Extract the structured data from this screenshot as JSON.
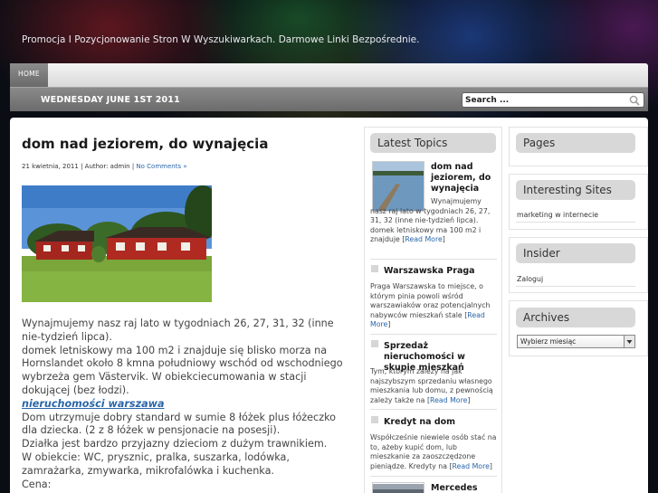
{
  "site": {
    "tagline": "Promocja I Pozycjonowanie Stron W Wyszukiwarkach. Darmowe Linki Bezpośrednie."
  },
  "nav": {
    "home_label": "HOME"
  },
  "datebar": {
    "date": "WEDNESDAY JUNE 1ST 2011"
  },
  "search": {
    "placeholder": "Search ..."
  },
  "post": {
    "title": "dom nad jeziorem, do wynajęcia",
    "meta_prefix": "21 kwietnia, 2011 | Author: admin | ",
    "comments_link": "No Comments »",
    "paragraphs": [
      "Wynajmujemy nasz raj lato w tygodniach 26, 27, 31, 32 (inne nie-tydzień lipca).",
      "domek letniskowy ma 100 m2 i znajduje się blisko morza na Hornslandet około 8 kmna południowy wschód od wschodniego wybrzeża gem Västervik. W obiekciecumowania w stacji dokującej (bez łodzi)."
    ],
    "keyword_link": "nieruchomości warszawa",
    "paragraphs2": [
      "Dom utrzymuje dobry standard w sumie 8 łóżek plus łóżeczko dla dziecka. (2 z 8 łóżek w pensjonacie na posesji).",
      "Działka jest bardzo przyjazny dzieciom z dużym trawnikiem.",
      "W obiekcie: WC, prysznic, pralka, suszarka, lodówka, zamrażarka, zmywarka, mikrofalówka i kuchenka.",
      "Cena:"
    ]
  },
  "latest_topics": {
    "heading": "Latest Topics",
    "read_more": "Read More",
    "items": [
      {
        "title": "dom nad jeziorem, do wynajęcia",
        "text": "Wynajmujemy nasz raj lato w tygodniach 26, 27, 31, 32 (inne nie-tydzień lipca). domek letniskowy ma 100 m2 i znajduje"
      },
      {
        "title": "Warszawska Praga",
        "text": "Praga Warszawska to miejsce, o którym pinia powoli wśród warszawiaków oraz potencjalnych nabywców mieszkań stale"
      },
      {
        "title": "Sprzedaż nieruchomości w skupie mieszkań",
        "text": "Tym, którym zależy na jak najszybszym sprzedaniu własnego mieszkania lub domu, z pewnością zależy także na"
      },
      {
        "title": "Kredyt na dom",
        "text": "Współcześnie niewiele osób stać na to, ażeby kupić dom, lub mieszkanie za zaoszczędzone pieniądze. Kredyty na"
      },
      {
        "title": "Mercedes",
        "text": ""
      }
    ]
  },
  "sidebar": {
    "pages_heading": "Pages",
    "interesting_heading": "Interesting Sites",
    "interesting_link": "marketing w internecie",
    "insider_heading": "Insider",
    "insider_link": "Zaloguj",
    "archives_heading": "Archives",
    "archives_select": "Wybierz miesiąc"
  },
  "colors": {
    "link": "#2a66a8",
    "nav_dark": "#777777",
    "side_head_bg": "#d8d8d8"
  }
}
